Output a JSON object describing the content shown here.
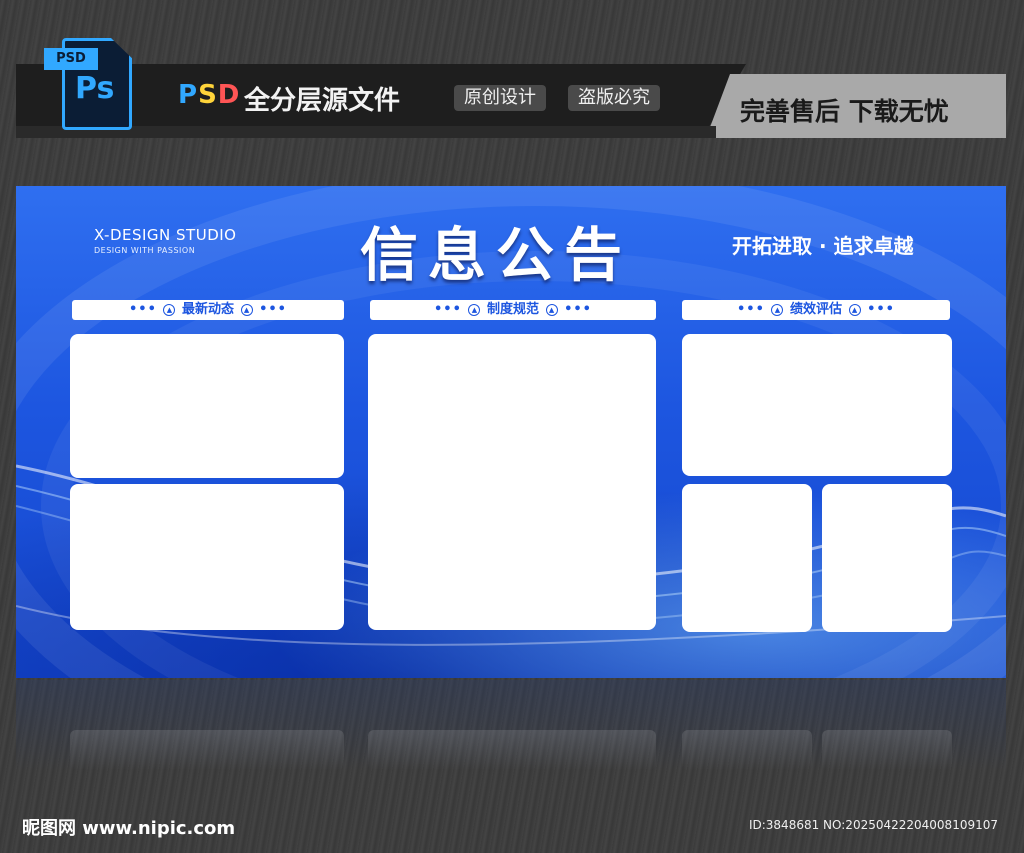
{
  "header": {
    "file_icon_tag": "PSD",
    "file_icon_letters": "Ps",
    "psd_p": "P",
    "psd_s": "S",
    "psd_d": "D",
    "full_layer_text": "全分层源文件",
    "pill_original": "原创设计",
    "pill_piracy": "盗版必究",
    "after_sale": "完善售后  下载无忧"
  },
  "board": {
    "studio_name": "X-DESIGN STUDIO",
    "studio_sub": "DESIGN WITH PASSION",
    "title": "信息公告",
    "slogan": "开拓进取 · 追求卓越",
    "sections": [
      {
        "label": "最新动态",
        "dots": "•••",
        "mark": "▲"
      },
      {
        "label": "制度规范",
        "dots": "•••",
        "mark": "▲"
      },
      {
        "label": "绩效评估",
        "dots": "•••",
        "mark": "▲"
      }
    ]
  },
  "footer": {
    "logo": "昵图网 www.nipic.com",
    "id": "ID:3848681 NO:20250422204008109107"
  },
  "colors": {
    "board_blue": "#1d56e0",
    "ps_blue": "#31a8ff",
    "psd_yellow": "#ffd43a",
    "psd_red": "#ff5555"
  }
}
